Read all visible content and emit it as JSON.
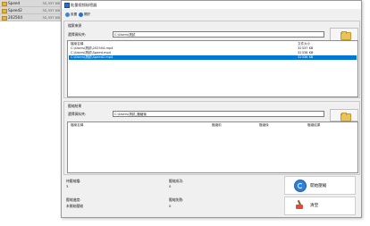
{
  "background_list": {
    "items": [
      {
        "name": "Speed",
        "size": "32,337 KB"
      },
      {
        "name": "Speed2",
        "size": "32,337 KB"
      },
      {
        "name": "202504",
        "size": "32,337 KB"
      }
    ]
  },
  "window": {
    "title": "批量视频秘密器"
  },
  "toolbar": {
    "items": [
      {
        "label": "設置"
      },
      {
        "label": "關於"
      }
    ]
  },
  "source": {
    "header": "檔案來源",
    "folder_label": "選擇資料夾:",
    "folder_value": "C:\\Users\\測試",
    "columns": {
      "name": "檔案名稱",
      "size": "文件大小"
    },
    "files": [
      {
        "name": "C:\\Users\\測試\\202504.mp4",
        "size": "32337 KB"
      },
      {
        "name": "C:\\Users\\測試\\Speed.mp4",
        "size": "32336 KB"
      },
      {
        "name": "C:\\Users\\測試\\Speed2.mp4",
        "size": "32336 KB"
      }
    ]
  },
  "output": {
    "header": "壓縮結果",
    "folder_label": "選擇資料夾:",
    "folder_value": "C:\\Users\\測試_壓縮後",
    "columns": {
      "name": "檔案名稱",
      "before": "壓縮前",
      "after": "壓縮後",
      "result": "壓縮結果"
    }
  },
  "stats": {
    "pending_label": "待壓縮檔:",
    "pending_value": "3",
    "success_label": "壓縮成功:",
    "success_value": "0",
    "progress_label": "壓縮進度:",
    "progress_value": "未開始壓縮",
    "fail_label": "壓縮失敗:",
    "fail_value": "0"
  },
  "buttons": {
    "start": "開始壓縮",
    "clear": "清空"
  }
}
